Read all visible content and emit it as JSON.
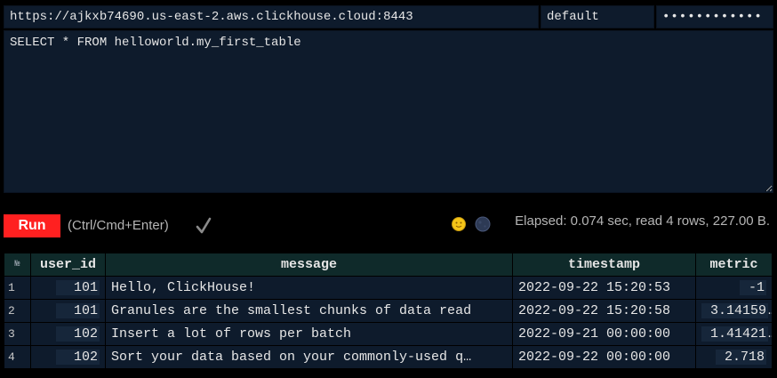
{
  "connection": {
    "url": "https://ajkxb74690.us-east-2.aws.clickhouse.cloud:8443",
    "user": "default",
    "password": "••••••••••••"
  },
  "query": "SELECT * FROM helloworld.my_first_table",
  "toolbar": {
    "run_label": "Run",
    "hint": "(Ctrl/Cmd+Enter)",
    "stats": "Elapsed: 0.074 sec, read 4 rows, 227.00 B."
  },
  "icons": {
    "check": "check-icon",
    "sun": "sun-icon",
    "moon": "moon-icon"
  },
  "colors": {
    "run_button": "#ff2020",
    "cell_background": "#0e1b2c",
    "header_background": "#0f2a2a",
    "sun": "#f5c518"
  },
  "results": {
    "row_number_header": "№",
    "columns": [
      "user_id",
      "message",
      "timestamp",
      "metric"
    ],
    "rows": [
      {
        "n": "1",
        "user_id": "101",
        "message": "Hello, ClickHouse!",
        "timestamp": "2022-09-22 15:20:53",
        "metric": "-1"
      },
      {
        "n": "2",
        "user_id": "101",
        "message": "Granules are the smallest chunks of data read",
        "timestamp": "2022-09-22 15:20:58",
        "metric": "3.14159"
      },
      {
        "n": "3",
        "user_id": "102",
        "message": "Insert a lot of rows per batch",
        "timestamp": "2022-09-21 00:00:00",
        "metric": "1.41421"
      },
      {
        "n": "4",
        "user_id": "102",
        "message": "Sort your data based on your commonly-used q…",
        "timestamp": "2022-09-22 00:00:00",
        "metric": "2.718"
      }
    ]
  }
}
